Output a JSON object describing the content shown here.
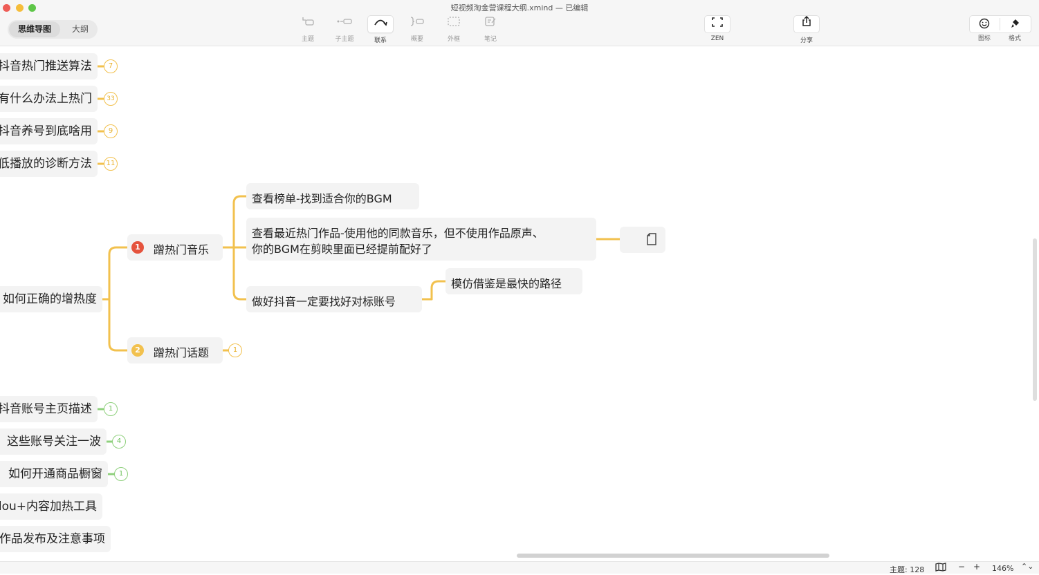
{
  "window": {
    "title": "短视频淘金营课程大纲.xmind — 已编辑"
  },
  "view_switch": {
    "mindmap": "思维导图",
    "outline": "大纲"
  },
  "toolbar": {
    "topic": {
      "label": "主题",
      "icon": "topic-icon"
    },
    "subtopic": {
      "label": "子主题",
      "icon": "subtopic-icon"
    },
    "relationship": {
      "label": "联系",
      "icon": "relationship-curve-icon"
    },
    "summary": {
      "label": "概要",
      "icon": "summary-bracket-icon"
    },
    "boundary": {
      "label": "外框",
      "icon": "boundary-dashed-box-icon"
    },
    "note": {
      "label": "笔记",
      "icon": "note-pencil-icon"
    },
    "zen": {
      "label": "ZEN",
      "icon": "fullscreen-icon"
    },
    "share": {
      "label": "分享",
      "icon": "share-icon"
    },
    "icon": {
      "label": "图标",
      "icon": "smiley-icon"
    },
    "format": {
      "label": "格式",
      "icon": "brush-icon"
    }
  },
  "mindmap": {
    "left_topics": [
      {
        "text": "抖音热门推送算法",
        "count": "7",
        "branch_color": "#f2c14e"
      },
      {
        "text": "有什么办法上热门",
        "count": "33",
        "branch_color": "#f2c14e"
      },
      {
        "text": "抖音养号到底啥用",
        "count": "9",
        "branch_color": "#f2c14e"
      },
      {
        "text": "低播放的诊断方法",
        "count": "11",
        "branch_color": "#f2c14e"
      },
      {
        "text": "如何正确的增热度",
        "count": "",
        "branch_color": "#f2c14e"
      },
      {
        "text": "抖音账号主页描述",
        "count": "1",
        "branch_color": "#8fd07d"
      },
      {
        "text": "这些账号关注一波",
        "count": "4",
        "branch_color": "#8fd07d"
      },
      {
        "text": "如何开通商品橱窗",
        "count": "1",
        "branch_color": "#8fd07d"
      },
      {
        "text": "dou+内容加热工具",
        "count": "",
        "branch_color": "#8fd07d"
      },
      {
        "text": "作品发布及注意事项",
        "count": "",
        "branch_color": "#8fd07d"
      }
    ],
    "subtopics": {
      "hot_music": {
        "marker": "1",
        "text": "蹭热门音乐",
        "marker_color": "#e5533d"
      },
      "hot_topic": {
        "marker": "2",
        "text": "蹭热门话题",
        "marker_color": "#f2c14e",
        "count": "1"
      },
      "check_chart": "查看榜单-找到适合你的BGM",
      "recent_hot_line1": "查看最近热门作品-使用他的同款音乐，但不使用作品原声、",
      "recent_hot_line2": "你的BGM在剪映里面已经提前配好了",
      "benchmark": "做好抖音一定要找好对标账号",
      "imitate": "模仿借鉴是最快的路径"
    },
    "branch_color": "#f2c14e"
  },
  "status": {
    "topic_count": "主题: 128",
    "zoom_out": "−",
    "zoom_in": "+",
    "zoom": "146%",
    "stepper": "⌃⌄"
  }
}
